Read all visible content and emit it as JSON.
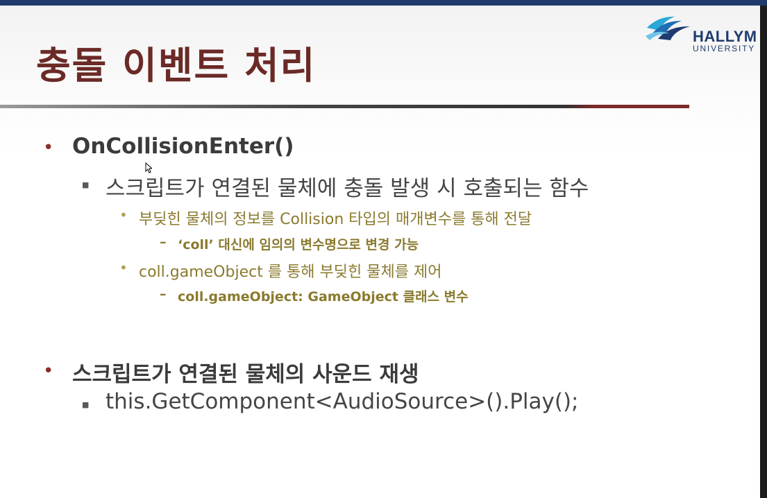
{
  "slide": {
    "title": "충돌 이벤트 처리",
    "logo": {
      "name": "HALLYM",
      "sub": "UNIVERSITY"
    },
    "sections": [
      {
        "heading": "OnCollisionEnter()",
        "sub": "스크립트가 연결된 물체에 충돌 발생 시 호출되는 함수",
        "items": [
          {
            "text": "부딪힌 물체의 정보를 Collision 타입의 매개변수를 통해 전달",
            "note": "‘coll’ 대신에 임의의 변수명으로 변경 가능"
          },
          {
            "text": "coll.gameObject 를 통해 부딪힌 물체를 제어",
            "note": "coll.gameObject: GameObject 클래스 변수"
          }
        ]
      },
      {
        "heading": "스크립트가 연결된 물체의 사운드 재생",
        "sub": "this.GetComponent<AudioSource>().Play();"
      }
    ]
  }
}
